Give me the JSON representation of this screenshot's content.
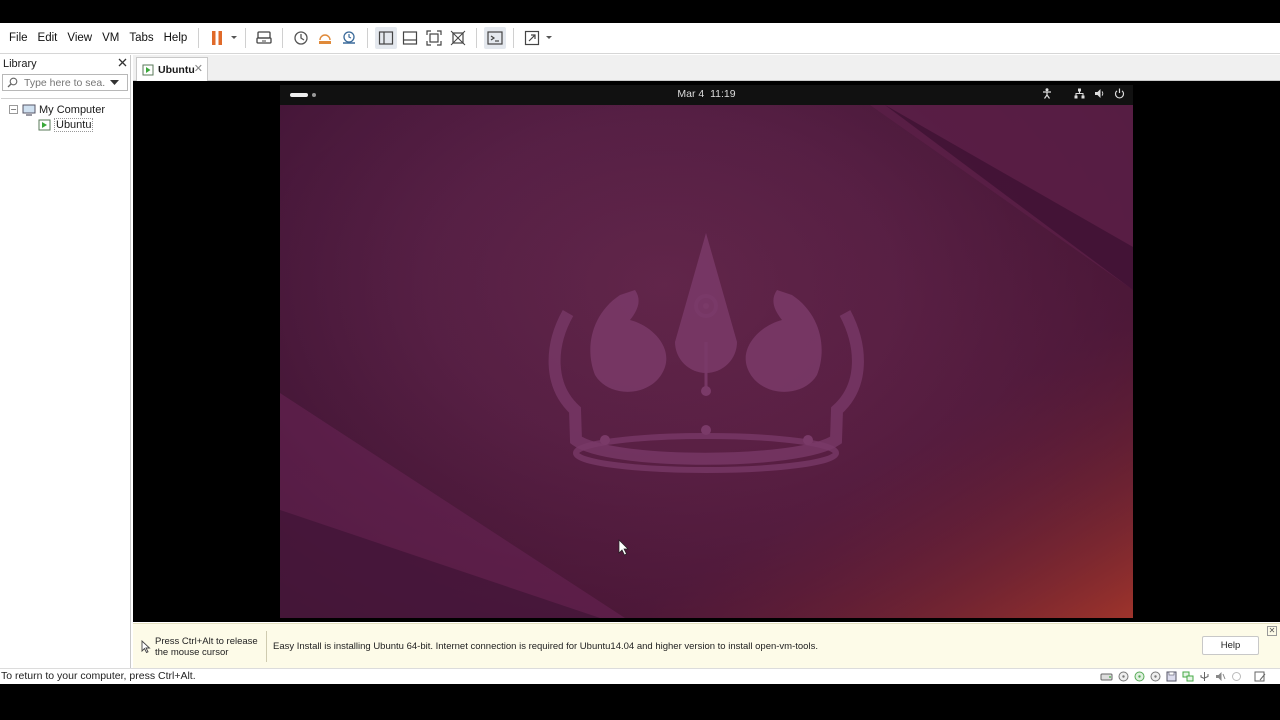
{
  "menu": [
    "File",
    "Edit",
    "View",
    "VM",
    "Tabs",
    "Help"
  ],
  "toolbar": {
    "icons": [
      "pause-icon",
      "send-ctrl-alt-del-icon",
      "snapshot-icon",
      "revert-snapshot-icon",
      "snapshot-manager-icon",
      "show-library-icon",
      "thumbnail-bar-icon",
      "full-screen-icon",
      "unity-icon",
      "console-view-icon",
      "stretch-guest-icon"
    ],
    "accent": "#e06a2a"
  },
  "library": {
    "title": "Library",
    "search_placeholder": "Type here to sea...",
    "tree": [
      {
        "label": "My Computer",
        "expanded": true
      },
      {
        "label": "Ubuntu",
        "selected": true
      }
    ]
  },
  "tabs": [
    {
      "label": "Ubuntu"
    }
  ],
  "guest": {
    "date": "Mar 4",
    "time": "11:19",
    "wallpaper": [
      "#2f0f27",
      "#5a2148",
      "#8a2a32"
    ]
  },
  "infobar": {
    "hint_line1": "Press Ctrl+Alt to release",
    "hint_line2": "the mouse cursor",
    "message": "Easy Install is installing Ubuntu 64-bit. Internet connection is required for Ubuntu14.04 and higher version to install open-vm-tools.",
    "help_label": "Help"
  },
  "statusbar": {
    "text": "To return to your computer, press Ctrl+Alt.",
    "icons": [
      "hard-disk-icon",
      "cd-icon",
      "cd-icon",
      "floppy-icon",
      "network-icon",
      "usb-icon",
      "sound-icon",
      "printer-icon",
      "message-icon"
    ]
  }
}
